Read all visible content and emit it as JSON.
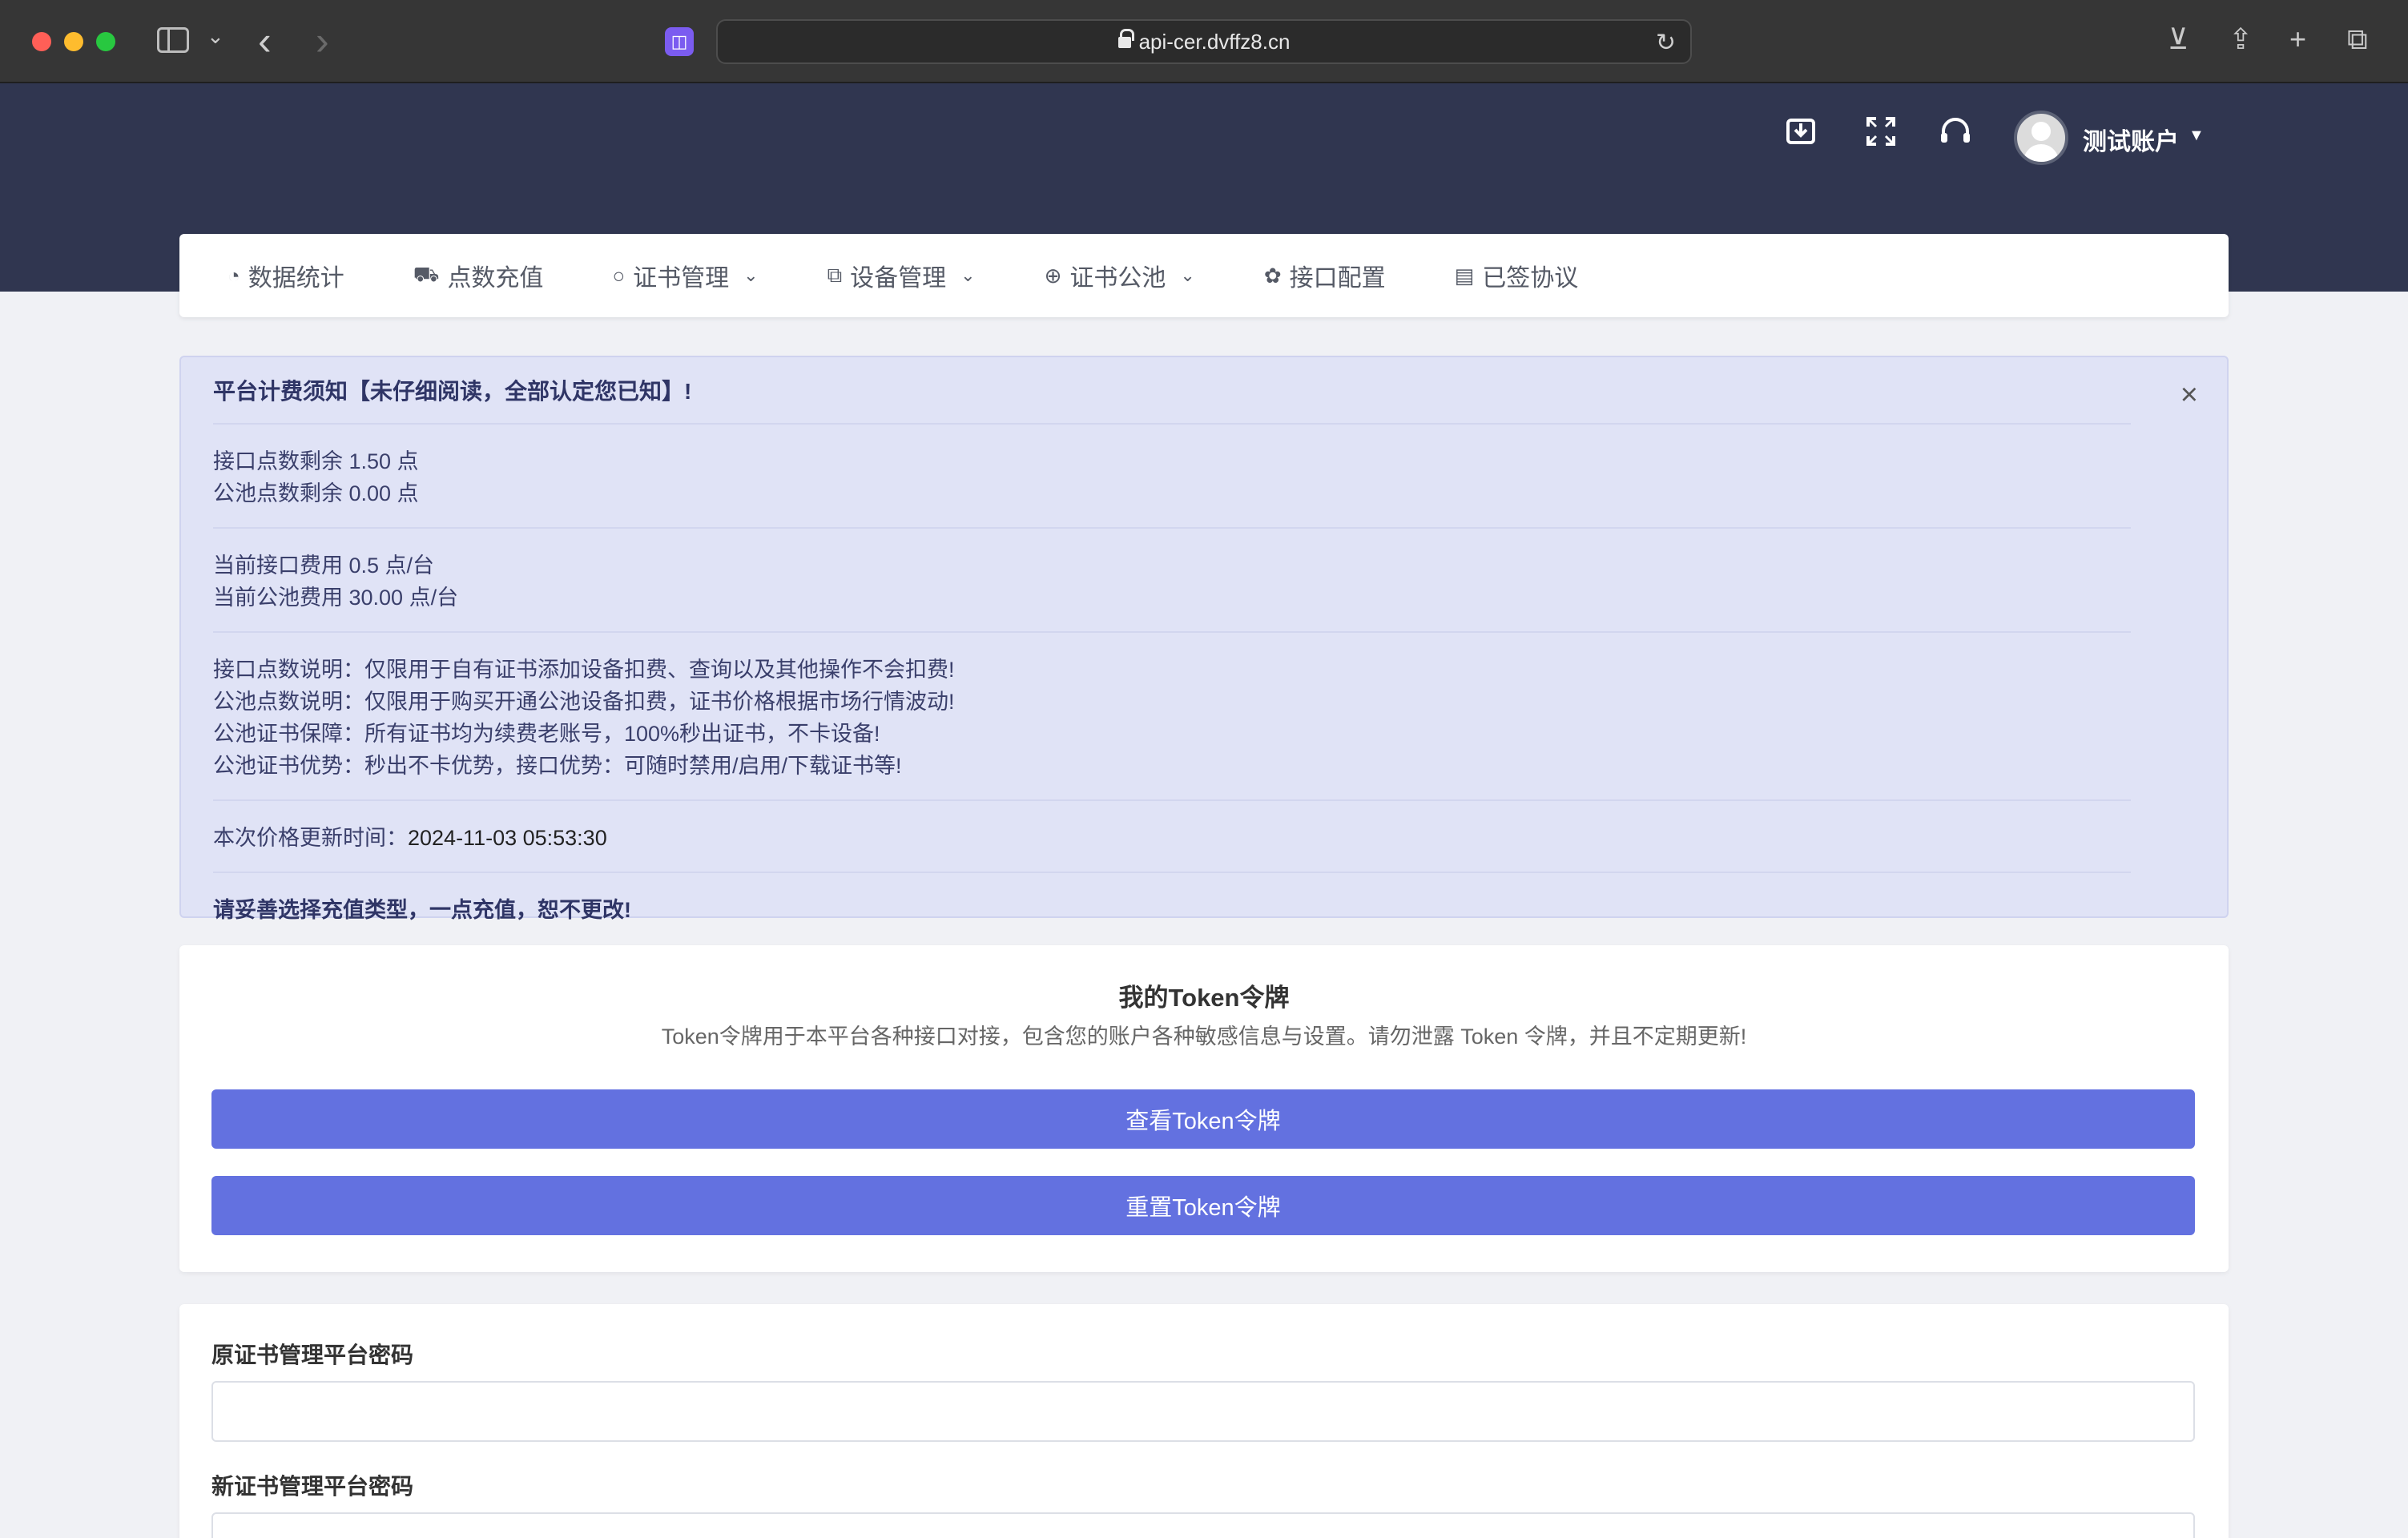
{
  "browser": {
    "url": "api-cer.dvffz8.cn",
    "ext_glyph": "◫"
  },
  "header": {
    "user_name": "测试账户"
  },
  "nav": {
    "items": [
      {
        "label": "数据统计",
        "icon": "◔",
        "has_caret": false
      },
      {
        "label": "点数充值",
        "icon": "⛟",
        "has_caret": false
      },
      {
        "label": "证书管理",
        "icon": "○",
        "has_caret": true
      },
      {
        "label": "设备管理",
        "icon": "⧉",
        "has_caret": true
      },
      {
        "label": "证书公池",
        "icon": "⊕",
        "has_caret": true
      },
      {
        "label": "接口配置",
        "icon": "✿",
        "has_caret": false
      },
      {
        "label": "已签协议",
        "icon": "▤",
        "has_caret": false
      }
    ]
  },
  "notice": {
    "title": "平台计费须知【未仔细阅读，全部认定您已知】!",
    "api_points": "接口点数剩余 1.50 点",
    "pool_points": "公池点数剩余 0.00 点",
    "api_fee": "当前接口费用 0.5 点/台",
    "pool_fee": "当前公池费用 30.00 点/台",
    "desc1": "接口点数说明：仅限用于自有证书添加设备扣费、查询以及其他操作不会扣费!",
    "desc2": "公池点数说明：仅限用于购买开通公池设备扣费，证书价格根据市场行情波动!",
    "desc3": "公池证书保障：所有证书均为续费老账号，100%秒出证书，不卡设备!",
    "desc4": "公池证书优势：秒出不卡优势，接口优势：可随时禁用/启用/下载证书等!",
    "update_label": "本次价格更新时间：",
    "update_time": "2024-11-03 05:53:30",
    "footer": "请妥善选择充值类型，一点充值，恕不更改!"
  },
  "token": {
    "title": "我的Token令牌",
    "description": "Token令牌用于本平台各种接口对接，包含您的账户各种敏感信息与设置。请勿泄露 Token 令牌，并且不定期更新!",
    "view_label": "查看Token令牌",
    "reset_label": "重置Token令牌"
  },
  "password": {
    "old_label": "原证书管理平台密码",
    "old_value": "",
    "new_label": "新证书管理平台密码",
    "new_value": ""
  },
  "colors": {
    "header_bg": "#303650",
    "primary_button": "#6371e0",
    "notice_bg": "#e0e3f6"
  }
}
